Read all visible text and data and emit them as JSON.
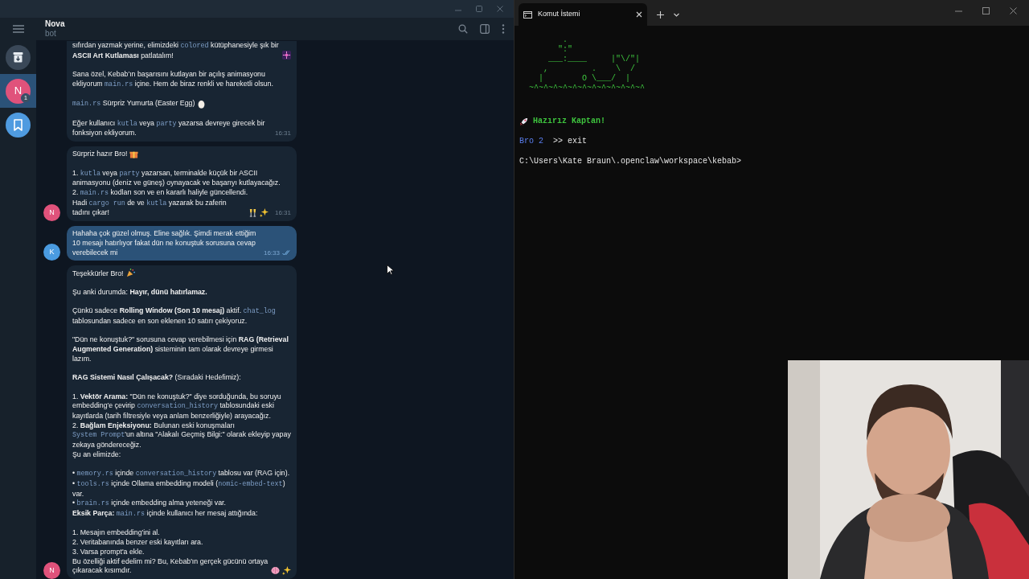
{
  "telegram": {
    "chat": {
      "name": "Nova",
      "status": "bot"
    },
    "sidebar": {
      "items": [
        {
          "kind": "archive",
          "selected": false
        },
        {
          "kind": "chat",
          "initial": "N",
          "badge": "1",
          "color": "#e0527b",
          "selected": true
        },
        {
          "kind": "saved",
          "selected": false
        }
      ]
    },
    "messages": [
      {
        "kind": "incoming",
        "time": "16:31",
        "blocks": [
          {
            "segments": [
              {
                "kind": "text",
                "text": "sıfırdan yazmak yerine, elimizdeki "
              },
              {
                "kind": "code",
                "text": "colored"
              },
              {
                "kind": "text",
                "text": " kütüphanesiyle şık bir **ASCII Art Kutlaması** patlatalım!"
              },
              {
                "kind": "fireworks"
              }
            ]
          },
          {
            "gap": true,
            "segments": [
              {
                "kind": "text",
                "text": "Sana özel, Kebab'ın başarısını kutlayan bir açılış animasyonu ekliyorum "
              },
              {
                "kind": "code",
                "text": "main.rs"
              },
              {
                "kind": "text",
                "text": " içine. Hem de biraz renkli ve hareketli olsun."
              }
            ]
          },
          {
            "gap": true,
            "segments": [
              {
                "kind": "code",
                "text": "main.rs"
              },
              {
                "kind": "text",
                "text": " Sürpriz Yumurta (Easter Egg)"
              },
              {
                "kind": "egg"
              }
            ]
          },
          {
            "gap": true,
            "segments": [
              {
                "kind": "text",
                "text": "Eğer kullanıcı "
              },
              {
                "kind": "code",
                "text": "kutla"
              },
              {
                "kind": "text",
                "text": " veya "
              },
              {
                "kind": "code",
                "text": "party"
              },
              {
                "kind": "text",
                "text": " yazarsa devreye girecek bir fonksiyon ekliyorum."
              }
            ]
          }
        ]
      },
      {
        "kind": "incoming",
        "time": "16:31",
        "avatar": {
          "initial": "N",
          "color": "#e0527b"
        },
        "blocks": [
          {
            "segments": [
              {
                "kind": "text",
                "text": "Sürpriz hazır Bro!"
              },
              {
                "kind": "gift"
              }
            ]
          },
          {
            "gap": true,
            "segments": [
              {
                "kind": "text",
                "text": "1. "
              },
              {
                "kind": "code",
                "text": "kutla"
              },
              {
                "kind": "text",
                "text": " veya "
              },
              {
                "kind": "code",
                "text": "party"
              },
              {
                "kind": "text",
                "text": " yazarsan, terminalde küçük bir ASCII animasyonu (deniz ve güneş) oynayacak ve başarıyı kutlayacağız."
              }
            ]
          },
          {
            "segments": [
              {
                "kind": "text",
                "text": "2. "
              },
              {
                "kind": "code",
                "text": "main.rs"
              },
              {
                "kind": "text",
                "text": " kodları son ve en kararlı haliyle güncellendi."
              }
            ]
          },
          {
            "segments": [
              {
                "kind": "text",
                "text": "Hadi "
              },
              {
                "kind": "code",
                "text": "cargo run"
              },
              {
                "kind": "text",
                "text": " de ve "
              },
              {
                "kind": "code",
                "text": "kutla"
              },
              {
                "kind": "text",
                "text": " yazarak bu zaferin tadını çıkar!"
              },
              {
                "kind": "cheers"
              },
              {
                "kind": "sparkles"
              }
            ]
          }
        ]
      },
      {
        "kind": "outgoing",
        "time": "16:33",
        "read": true,
        "avatar": {
          "initial": "K",
          "color": "#4a9be0"
        },
        "blocks": [
          {
            "segments": [
              {
                "kind": "text",
                "text": "Hahaha çok güzel olmuş. Eline sağlık. Şimdi merak ettiğim 10 mesajı hatırlıyor fakat dün ne konuştuk sorusuna cevap verebilecek mi"
              }
            ]
          }
        ]
      },
      {
        "kind": "incoming",
        "avatar": {
          "initial": "N",
          "color": "#e0527b"
        },
        "blocks": [
          {
            "segments": [
              {
                "kind": "text",
                "text": "Teşekkürler Bro!"
              },
              {
                "kind": "party"
              }
            ]
          },
          {
            "gap": true,
            "segments": [
              {
                "kind": "text",
                "text": "Şu anki durumda: **Hayır, dünü hatırlamaz.**"
              }
            ]
          },
          {
            "gap": true,
            "segments": [
              {
                "kind": "text",
                "text": "Çünkü sadece **Rolling Window (Son 10 mesaj)** aktif. "
              },
              {
                "kind": "code",
                "text": "chat_log"
              },
              {
                "kind": "text",
                "text": " tablosundan sadece en son eklenen 10 satırı çekiyoruz."
              }
            ]
          },
          {
            "gap": true,
            "segments": [
              {
                "kind": "text",
                "text": "\"Dün ne konuştuk?\" sorusuna cevap verebilmesi için **RAG (Retrieval Augmented Generation)** sisteminin tam olarak devreye girmesi lazım."
              }
            ]
          },
          {
            "gap": true,
            "segments": [
              {
                "kind": "text",
                "text": "**RAG Sistemi Nasıl Çalışacak?** (Sıradaki Hedefimiz):"
              }
            ]
          },
          {
            "gap": true,
            "segments": [
              {
                "kind": "text",
                "text": "1. **Vektör Arama:** \"Dün ne konuştuk?\" diye sorduğunda, bu soruyu embedding'e çevirip "
              },
              {
                "kind": "code",
                "text": "conversation_history"
              },
              {
                "kind": "text",
                "text": " tablosundaki eski kayıtlarda (tarih filtresiyle veya anlam benzerliğiyle) arayacağız."
              }
            ]
          },
          {
            "segments": [
              {
                "kind": "text",
                "text": "2. **Bağlam Enjeksiyonu:** Bulunan eski konuşmaları "
              },
              {
                "kind": "code",
                "text": "System Prompt"
              },
              {
                "kind": "text",
                "text": "'un altına \"Alakalı Geçmiş Bilgi:\" olarak ekleyip yapay zekaya göndereceğiz."
              }
            ]
          },
          {
            "segments": [
              {
                "kind": "text",
                "text": "Şu an elimizde:"
              }
            ]
          },
          {
            "gap": true,
            "segments": [
              {
                "kind": "text",
                "text": "• "
              },
              {
                "kind": "code",
                "text": "memory.rs"
              },
              {
                "kind": "text",
                "text": " içinde "
              },
              {
                "kind": "code",
                "text": "conversation_history"
              },
              {
                "kind": "text",
                "text": " tablosu var (RAG için)."
              }
            ]
          },
          {
            "segments": [
              {
                "kind": "text",
                "text": "• "
              },
              {
                "kind": "code",
                "text": "tools.rs"
              },
              {
                "kind": "text",
                "text": " içinde Ollama embedding modeli ("
              },
              {
                "kind": "code",
                "text": "nomic-embed-text"
              },
              {
                "kind": "text",
                "text": ") var."
              }
            ]
          },
          {
            "segments": [
              {
                "kind": "text",
                "text": "• "
              },
              {
                "kind": "code",
                "text": "brain.rs"
              },
              {
                "kind": "text",
                "text": " içinde embedding alma yeteneği var."
              }
            ]
          },
          {
            "segments": [
              {
                "kind": "text",
                "text": "**Eksik Parça:** "
              },
              {
                "kind": "code",
                "text": "main.rs"
              },
              {
                "kind": "text",
                "text": " içinde kullanıcı her mesaj attığında:"
              }
            ]
          },
          {
            "gap": true,
            "segments": [
              {
                "kind": "text",
                "text": "1. Mesajın embedding'ini al."
              }
            ]
          },
          {
            "segments": [
              {
                "kind": "text",
                "text": "2. Veritabanında benzer eski kayıtları ara."
              }
            ]
          },
          {
            "segments": [
              {
                "kind": "text",
                "text": "3. Varsa prompt'a ekle."
              }
            ]
          },
          {
            "segments": [
              {
                "kind": "text",
                "text": "Bu özelliği aktif edelim mi? Bu, Kebab'ın gerçek gücünü ortaya çıkaracak kısımdır."
              },
              {
                "kind": "brain"
              },
              {
                "kind": "sparkles"
              }
            ]
          }
        ]
      }
    ]
  },
  "terminal": {
    "tab": {
      "title": "Komut İstemi",
      "selected": true
    },
    "art": [
      "         .",
      "        \":\"",
      "      ___:____     |\"\\/\"|",
      "     ,         .    \\  /",
      "    |        O \\___/  |",
      "  ~^~^~^~^~^~^~^~^~^~^~^~^"
    ],
    "lines": [
      [
        {
          "kind": "rocket"
        },
        {
          "kind": "text",
          "text": "Hazırız Kaptan!",
          "color": "#3ec43e",
          "bold": true
        }
      ],
      [
        {
          "kind": "text",
          "text": "Bro 2",
          "color": "#5b7ff0"
        },
        {
          "kind": "text",
          "text": ">> exit"
        }
      ],
      [
        {
          "kind": "text",
          "text": "C:\\Users\\Kate Braun\\.openclaw\\workspace\\kebab>",
          "color": "#e6e6e6"
        }
      ]
    ]
  }
}
